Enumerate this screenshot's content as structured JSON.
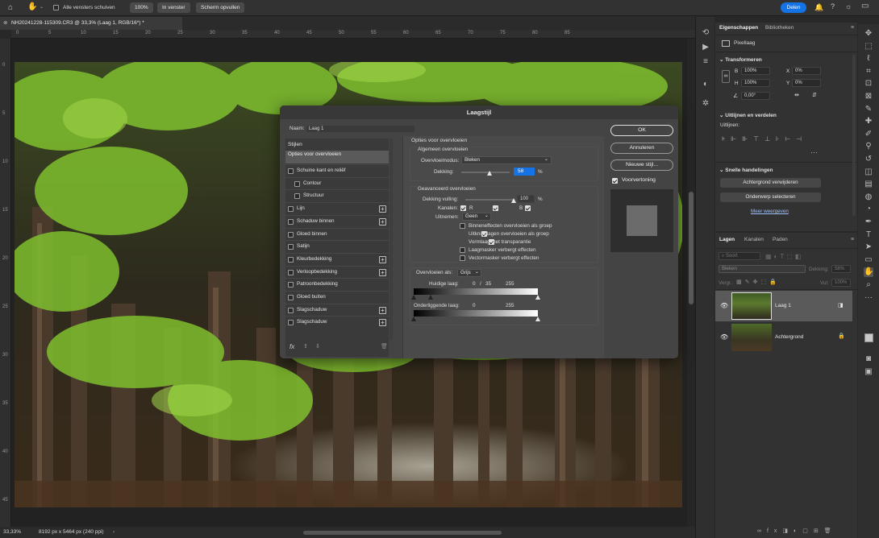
{
  "optionsbar": {
    "all_windows_label": "Alle vensters schuiven",
    "zoom_btn": "100%",
    "fit_btn": "In venster",
    "fill_btn": "Scherm opvullen",
    "share_btn": "Delen"
  },
  "document": {
    "tab_title": "NH20241228-115309.CR3 @ 33,3% (Laag 1, RGB/16*) *",
    "close_glyph": "⊗"
  },
  "rulers": {
    "h_labels": [
      "0",
      "5",
      "10",
      "15",
      "20",
      "25",
      "30",
      "35",
      "40",
      "45",
      "50",
      "55",
      "60",
      "65",
      "70",
      "75",
      "80",
      "85"
    ],
    "v_labels": [
      "0",
      "5",
      "10",
      "15",
      "20",
      "25",
      "30",
      "35",
      "40",
      "45"
    ]
  },
  "status": {
    "zoom": "33,33%",
    "dimensions": "8192 px x 5464 px (240 ppi)"
  },
  "properties": {
    "tab_props": "Eigenschappen",
    "tab_libs": "Bibliotheken",
    "layer_kind": "Pixellaag",
    "transform_title": "Transformeren",
    "w_label": "B",
    "w_value": "100%",
    "x_label": "X",
    "x_value": "0%",
    "h_label": "H",
    "h_value": "100%",
    "y_label": "Y",
    "y_value": "0%",
    "angle_value": "0,00°",
    "align_title": "Uitlijnen en verdelen",
    "align_label": "Uitlijnen:",
    "quick_title": "Snelle handelingen",
    "quick_btn1": "Achtergrond verwijderen",
    "quick_btn2": "Onderwerp selecteren",
    "more_link": "Meer weergeven"
  },
  "layers": {
    "tab_layers": "Lagen",
    "tab_channels": "Kanalen",
    "tab_paths": "Paden",
    "search_placeholder": "Soort",
    "blend_mode": "Bleken",
    "opacity_label": "Dekking:",
    "opacity_value": "58%",
    "lock_label": "Vergr.:",
    "fill_label": "Vul:",
    "fill_value": "100%",
    "items": [
      {
        "name": "Laag 1"
      },
      {
        "name": "Achtergrond"
      }
    ]
  },
  "dialog": {
    "title": "Laagstijl",
    "name_label": "Naam:",
    "name_value": "Laag 1",
    "styles_header": "Stijlen",
    "blend_options": "Opties voor overvloeien",
    "styles": [
      {
        "label": "Schuine kant en reliëf",
        "plus": false
      },
      {
        "label": "Contour",
        "plus": false
      },
      {
        "label": "Structuur",
        "plus": false
      },
      {
        "label": "Lijn",
        "plus": true
      },
      {
        "label": "Schaduw binnen",
        "plus": true
      },
      {
        "label": "Gloed binnen",
        "plus": false
      },
      {
        "label": "Satijn",
        "plus": false
      },
      {
        "label": "Kleurbedekking",
        "plus": true
      },
      {
        "label": "Verloopbedekking",
        "plus": true
      },
      {
        "label": "Patroonbedekking",
        "plus": false
      },
      {
        "label": "Gloed buiten",
        "plus": false
      },
      {
        "label": "Slagschaduw",
        "plus": true
      },
      {
        "label": "Slagschaduw",
        "plus": true
      }
    ],
    "fx_label": "fx",
    "section_title": "Opties voor overvloeien",
    "general_title": "Algemeen overvloeien",
    "blend_mode_label": "Overvloeimodus:",
    "blend_mode_value": "Bleken",
    "opacity_label": "Dekking:",
    "opacity_value": "58",
    "opacity_fraction": 0.58,
    "percent": "%",
    "advanced_title": "Geavanceerd overvloeien",
    "fill_label": "Dekking vulling:",
    "fill_value": "100",
    "fill_fraction": 1.0,
    "channels_label": "Kanalen:",
    "ch_r": "R",
    "ch_g": "G",
    "ch_b": "B",
    "knockout_label": "Uitnemen:",
    "knockout_value": "Geen",
    "opt1": "Binneneffecten overvloeien als groep",
    "opt2": "Uitknipplagen overvloeien als groep",
    "opt3": "Vormlaag met transparantie",
    "opt4": "Laagmasker verbergt effecten",
    "opt5": "Vectormasker verbergt effecten",
    "blendif_label": "Overvloeien als:",
    "blendif_value": "Grijs",
    "this_layer_label": "Huidige laag:",
    "this_v1": "0",
    "this_sep": "/",
    "this_v2": "35",
    "this_v3": "255",
    "under_layer_label": "Onderliggende laag:",
    "under_v1": "0",
    "under_v2": "255",
    "ok": "OK",
    "cancel": "Annuleren",
    "new_style": "Nieuwe stijl...",
    "preview": "Voorvertoning"
  },
  "colors": {
    "accent": "#1473e6",
    "dialog_bg": "#444444",
    "selected": "#5a5a5a",
    "foliage": "#7fbf2e"
  }
}
